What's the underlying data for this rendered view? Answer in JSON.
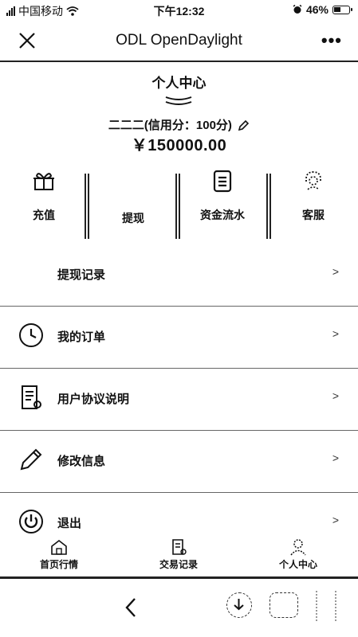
{
  "status_bar": {
    "carrier": "中国移动",
    "time": "下午12:32",
    "battery": "46%"
  },
  "navbar": {
    "title": "ODL OpenDaylight"
  },
  "profile": {
    "title": "个人中心",
    "user": "二二二(信用分：100分)",
    "balance": "￥150000.00"
  },
  "quick_actions": [
    {
      "label": "充值",
      "icon": "gift-icon"
    },
    {
      "label": "提现",
      "icon": ""
    },
    {
      "label": "资金流水",
      "icon": "clipboard-icon"
    },
    {
      "label": "客服",
      "icon": "headset-icon"
    }
  ],
  "menu": [
    {
      "label": "提现记录",
      "icon": ""
    },
    {
      "label": "我的订单",
      "icon": "clock-icon"
    },
    {
      "label": "用户协议说明",
      "icon": "document-icon"
    },
    {
      "label": "修改信息",
      "icon": "pencil-icon"
    },
    {
      "label": "退出",
      "icon": "power-icon"
    }
  ],
  "tabbar": [
    {
      "label": "首页行情",
      "icon": "home-icon"
    },
    {
      "label": "交易记录",
      "icon": "document-icon"
    },
    {
      "label": "个人中心",
      "icon": "user-icon"
    }
  ]
}
